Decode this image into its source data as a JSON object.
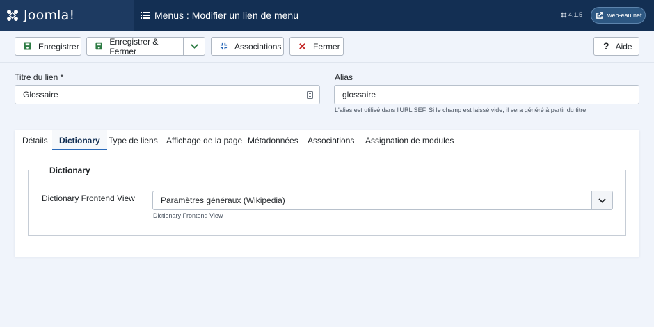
{
  "header": {
    "logo_text": "Joomla!",
    "title": "Menus : Modifier un lien de menu",
    "version": "4.1.5",
    "site_label": "web-eau.net",
    "bg_color": "#132f53",
    "logo_bg_color": "#1d3a61"
  },
  "toolbar": {
    "save_label": "Enregistrer",
    "save_close_label": "Enregistrer & Fermer",
    "associations_label": "Associations",
    "close_label": "Fermer",
    "help_label": "Aide",
    "save_icon": "floppy-disk-icon",
    "associations_icon": "associations-icon",
    "close_icon": "close-x-icon",
    "help_icon": "question-mark-icon"
  },
  "form": {
    "title_label": "Titre du lien *",
    "title_value": "Glossaire",
    "alias_label": "Alias",
    "alias_value": "glossaire",
    "alias_hint": "L'alias est utilisé dans l'URL SEF. Si le champ est laissé vide, il sera généré à partir du titre."
  },
  "tabs": [
    {
      "label": "Détails",
      "active": false
    },
    {
      "label": "Dictionary",
      "active": true
    },
    {
      "label": "Type de liens",
      "active": false
    },
    {
      "label": "Affichage de la page",
      "active": false
    },
    {
      "label": "Métadonnées",
      "active": false
    },
    {
      "label": "Associations",
      "active": false
    },
    {
      "label": "Assignation de modules",
      "active": false
    }
  ],
  "dictionary": {
    "legend": "Dictionary",
    "view_label": "Dictionary Frontend View",
    "view_selected": "Paramètres généraux (Wikipedia)",
    "view_hint": "Dictionary Frontend View"
  },
  "colors": {
    "accent": "#2a69b8",
    "save_icon": "#2d7b43",
    "close_icon": "#c52827",
    "page_bg": "#f0f4fb"
  }
}
